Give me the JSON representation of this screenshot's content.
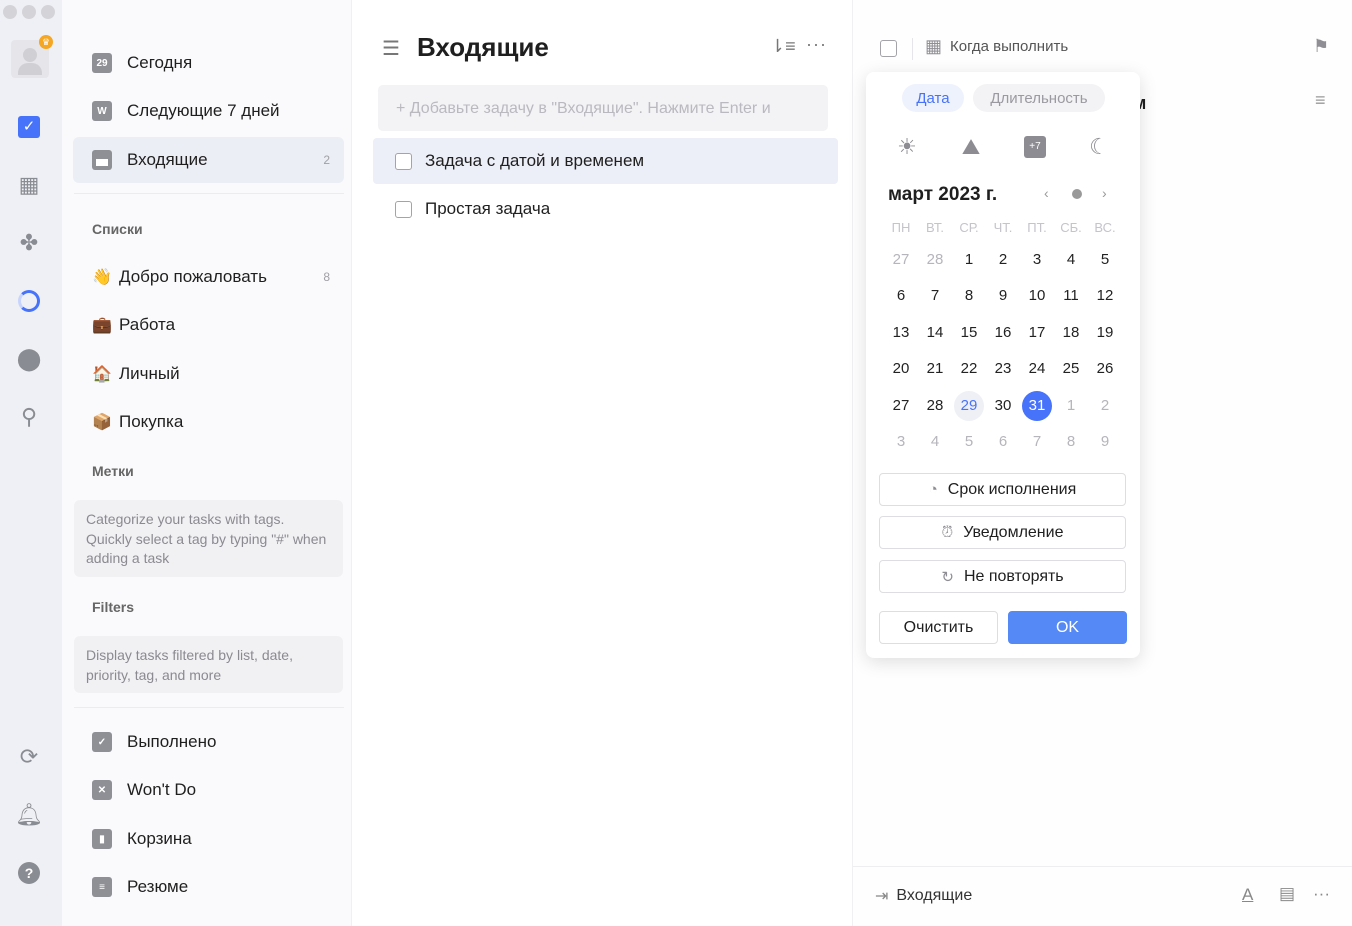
{
  "rail": {
    "items": [
      "avatar",
      "tasks-icon",
      "calendar-icon",
      "matrix-icon",
      "habit-icon",
      "pomodoro-icon",
      "search-icon"
    ],
    "bottom": [
      "sync-icon",
      "bell-icon",
      "help-icon"
    ],
    "accent": "#4772fa",
    "badge_color": "#f5a623"
  },
  "sidebar": {
    "smart": [
      {
        "label": "Сегодня",
        "icon": "29"
      },
      {
        "label": "Следующие 7 дней",
        "icon": "W"
      },
      {
        "label": "Входящие",
        "icon": "",
        "count": "2"
      }
    ],
    "lists_header": "Списки",
    "lists": [
      {
        "emoji": "👋",
        "label": "Добро пожаловать",
        "count": "8"
      },
      {
        "emoji": "💼",
        "label": "Работа"
      },
      {
        "emoji": "🏠",
        "label": "Личный"
      },
      {
        "emoji": "📦",
        "label": "Покупка"
      }
    ],
    "tags_header": "Метки",
    "tags_hint": "Categorize your tasks with tags. Quickly select a tag by typing \"#\" when adding a task",
    "filters_header": "Filters",
    "filters_hint": "Display tasks filtered by list, date, priority, tag, and more",
    "bottom": [
      {
        "label": "Выполнено",
        "icon": "✓"
      },
      {
        "label": "Won't Do",
        "icon": "✕"
      },
      {
        "label": "Корзина",
        "icon": "🗑"
      },
      {
        "label": "Резюме",
        "icon": "≡"
      }
    ]
  },
  "main": {
    "title": "Входящие",
    "add_placeholder": "+ Добавьте задачу в \"Входящие\". Нажмите Enter и",
    "tasks": [
      {
        "title": "Задача с датой и временем",
        "selected": true
      },
      {
        "title": "Простая задача",
        "selected": false
      }
    ]
  },
  "detail": {
    "when_label": "Когда выполнить",
    "title_fragment": "м",
    "list_name": "Входящие"
  },
  "picker": {
    "tabs": [
      "Дата",
      "Длительность"
    ],
    "active_tab": "Дата",
    "quick": [
      "sun-icon",
      "sunrise-icon",
      "plus7-icon",
      "moon-icon"
    ],
    "quick_plus7": "+7",
    "month_label": "март 2023 г.",
    "weekdays": [
      "ПН",
      "ВТ.",
      "СР.",
      "ЧТ.",
      "ПТ.",
      "СБ.",
      "ВС."
    ],
    "weeks": [
      [
        "27",
        "28",
        "1",
        "2",
        "3",
        "4",
        "5"
      ],
      [
        "6",
        "7",
        "8",
        "9",
        "10",
        "11",
        "12"
      ],
      [
        "13",
        "14",
        "15",
        "16",
        "17",
        "18",
        "19"
      ],
      [
        "20",
        "21",
        "22",
        "23",
        "24",
        "25",
        "26"
      ],
      [
        "27",
        "28",
        "29",
        "30",
        "31",
        "1",
        "2"
      ],
      [
        "3",
        "4",
        "5",
        "6",
        "7",
        "8",
        "9"
      ]
    ],
    "today": "29",
    "selected": "31",
    "due_label": "Срок исполнения",
    "reminder_label": "Уведомление",
    "repeat_label": "Не повторять",
    "clear_label": "Очистить",
    "ok_label": "OK"
  }
}
